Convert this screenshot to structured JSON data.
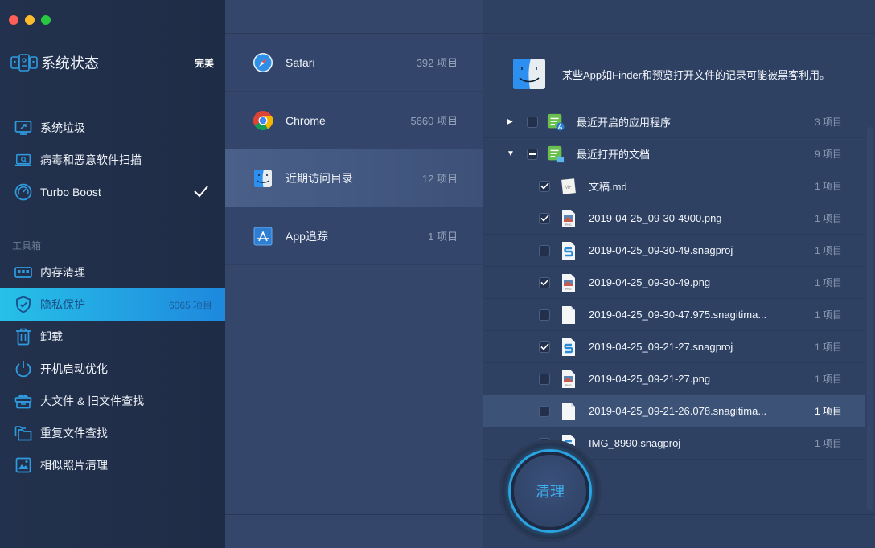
{
  "window": {
    "controls": [
      "close",
      "minimize",
      "zoom"
    ]
  },
  "sidebar": {
    "status": {
      "title": "系统状态",
      "state": "完美"
    },
    "items": [
      {
        "label": "系统垃圾",
        "icon": "monitor-icon"
      },
      {
        "label": "病毒和恶意软件扫描",
        "icon": "laptop-scan-icon"
      },
      {
        "label": "Turbo Boost",
        "icon": "speedometer-icon",
        "checked": "✓"
      }
    ],
    "section_label": "工具箱",
    "tools": [
      {
        "label": "内存清理",
        "icon": "memory-icon"
      },
      {
        "label": "隐私保护",
        "icon": "shield-check-icon",
        "count": "6065 项目",
        "active": true
      },
      {
        "label": "卸载",
        "icon": "trash-icon"
      },
      {
        "label": "开机启动优化",
        "icon": "power-icon"
      },
      {
        "label": "大文件 & 旧文件查找",
        "icon": "box-icon"
      },
      {
        "label": "重复文件查找",
        "icon": "folders-icon"
      },
      {
        "label": "相似照片清理",
        "icon": "photo-icon"
      }
    ]
  },
  "apps": [
    {
      "name": "Safari",
      "count": "392 项目",
      "icon": "safari-icon"
    },
    {
      "name": "Chrome",
      "count": "5660 项目",
      "icon": "chrome-icon"
    },
    {
      "name": "近期访问目录",
      "count": "12 项目",
      "icon": "finder-icon",
      "selected": true
    },
    {
      "name": "App追踪",
      "count": "1 项目",
      "icon": "app-store-icon"
    }
  ],
  "detail": {
    "banner": "某些App如Finder和预览打开文件的记录可能被黑客利用。",
    "groups": [
      {
        "label": "最近开启的应用程序",
        "count": "3 项目",
        "expanded": false,
        "checked": "none"
      },
      {
        "label": "最近打开的文档",
        "count": "9 项目",
        "expanded": true,
        "checked": "mixed"
      }
    ],
    "files": [
      {
        "name": "文稿.md",
        "count": "1 项目",
        "checked": true,
        "type": "md"
      },
      {
        "name": "2019-04-25_09-30-4900.png",
        "count": "1 项目",
        "checked": true,
        "type": "png"
      },
      {
        "name": "2019-04-25_09-30-49.snagproj",
        "count": "1 项目",
        "checked": false,
        "type": "snag"
      },
      {
        "name": "2019-04-25_09-30-49.png",
        "count": "1 项目",
        "checked": true,
        "type": "png"
      },
      {
        "name": "2019-04-25_09-30-47.975.snagitima...",
        "count": "1 项目",
        "checked": false,
        "type": "blank"
      },
      {
        "name": "2019-04-25_09-21-27.snagproj",
        "count": "1 项目",
        "checked": true,
        "type": "snag"
      },
      {
        "name": "2019-04-25_09-21-27.png",
        "count": "1 项目",
        "checked": false,
        "type": "png"
      },
      {
        "name": "2019-04-25_09-21-26.078.snagitima...",
        "count": "1 项目",
        "checked": false,
        "type": "blank",
        "highlighted": true
      },
      {
        "name": "IMG_8990.snagproj",
        "count": "1 项目",
        "checked": false,
        "type": "snag"
      }
    ]
  },
  "actions": {
    "clean_label": "清理"
  },
  "colors": {
    "accent": "#2ba3e0",
    "active_nav_start": "#27c0e8",
    "active_nav_end": "#1e88dd",
    "sidebar_bg": "#22314d",
    "panel_bg": "#34466a"
  }
}
